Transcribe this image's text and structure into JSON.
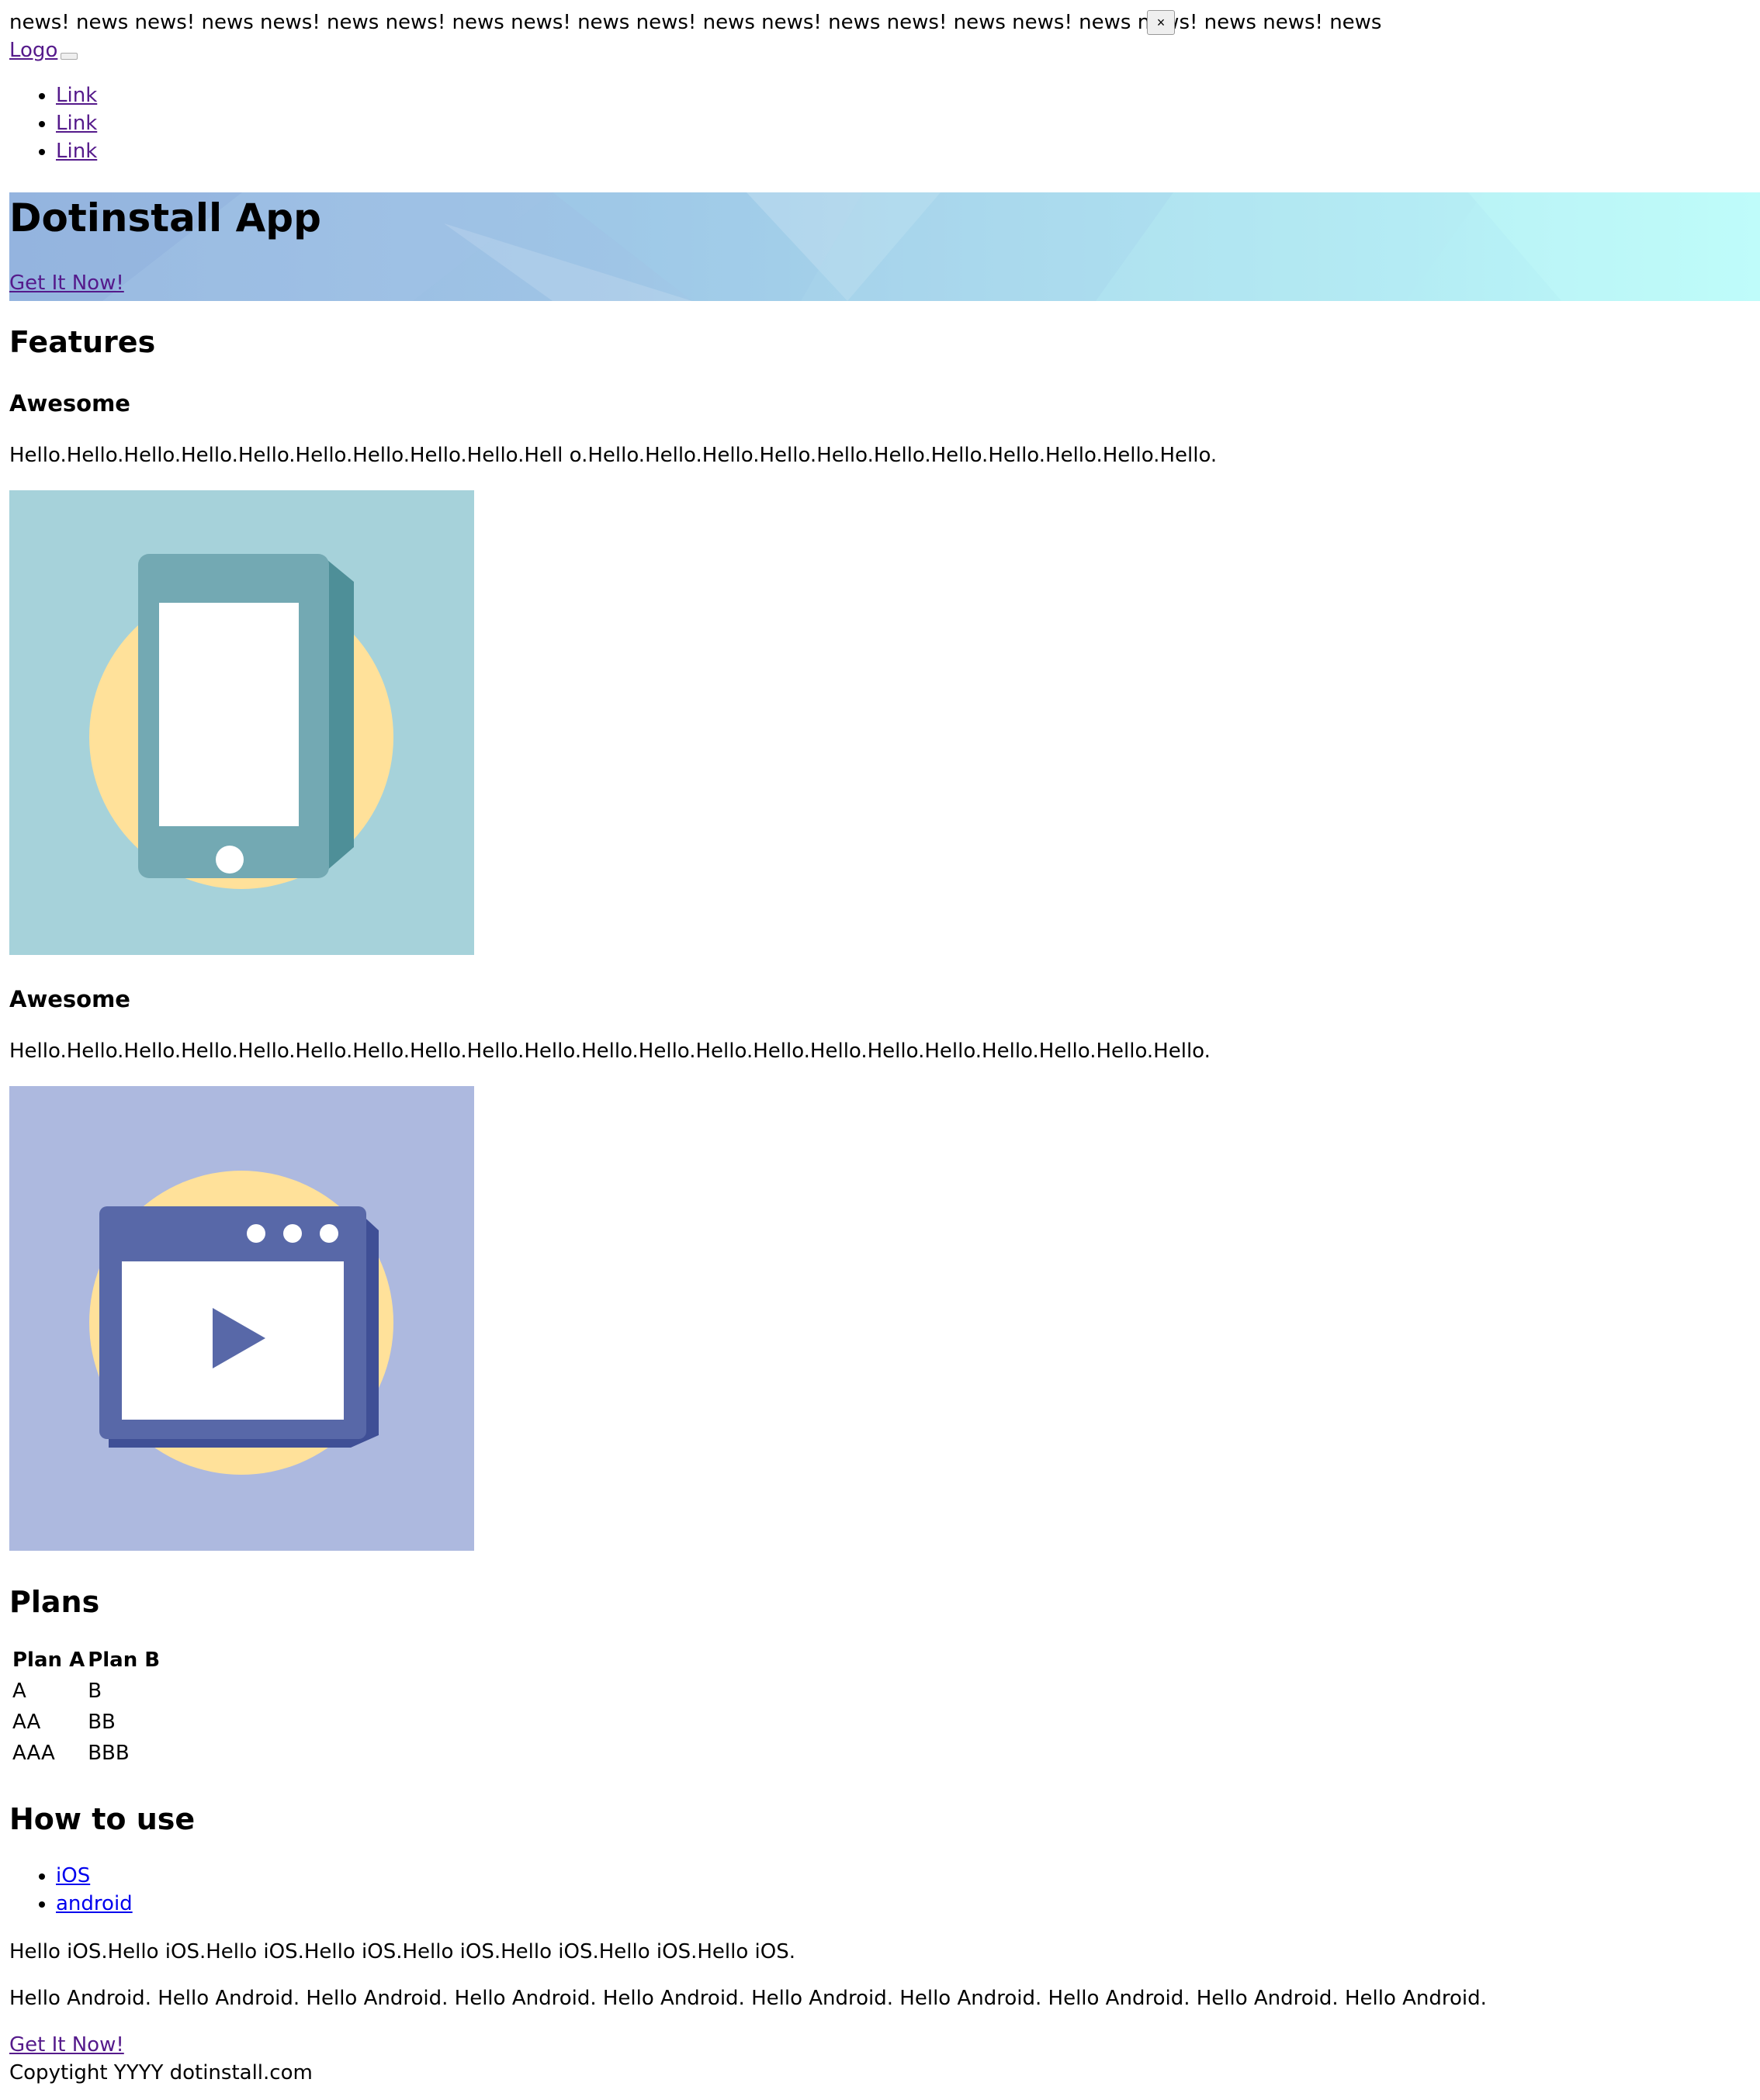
{
  "banner": {
    "text": "news! news news! news news! news news! news news! news news! news news! news news! news news! news news! news news! news",
    "close_label": "×"
  },
  "header": {
    "logo_label": "Logo",
    "nav_links": [
      "Link",
      "Link",
      "Link"
    ]
  },
  "hero": {
    "title": "Dotinstall App",
    "cta_label": "Get It Now!"
  },
  "features": {
    "heading": "Features",
    "items": [
      {
        "title": "Awesome",
        "text": "Hello.Hello.Hello.Hello.Hello.Hello.Hello.Hello.Hello.Hell o.Hello.Hello.Hello.Hello.Hello.Hello.Hello.Hello.Hello.Hello.Hello.",
        "icon": "smartphone-icon"
      },
      {
        "title": "Awesome",
        "text": "Hello.Hello.Hello.Hello.Hello.Hello.Hello.Hello.Hello.Hello.Hello.Hello.Hello.Hello.Hello.Hello.Hello.Hello.Hello.Hello.Hello.",
        "icon": "video-player-icon"
      }
    ]
  },
  "plans": {
    "heading": "Plans",
    "columns": [
      "Plan A",
      "Plan B"
    ],
    "rows": [
      [
        "A",
        "B"
      ],
      [
        "AA",
        "BB"
      ],
      [
        "AAA",
        "BBB"
      ]
    ]
  },
  "howto": {
    "heading": "How to use",
    "tabs": [
      "iOS",
      "android"
    ],
    "ios_text": "Hello iOS.Hello iOS.Hello iOS.Hello iOS.Hello iOS.Hello iOS.Hello iOS.Hello iOS.",
    "android_text": "Hello Android. Hello Android. Hello Android. Hello Android. Hello Android. Hello Android. Hello Android. Hello Android. Hello Android. Hello Android."
  },
  "footer": {
    "cta_label": "Get It Now!",
    "copyright": "Copytight YYYY dotinstall.com"
  },
  "colors": {
    "visited_link": "#551a8b",
    "link": "#0000ee",
    "hero_gradient_start": "#97b7e0",
    "hero_gradient_end": "#bdfcfa",
    "feature1_bg": "#a6d2da",
    "feature2_bg": "#adb9df",
    "accent_yellow": "#ffe19a"
  }
}
